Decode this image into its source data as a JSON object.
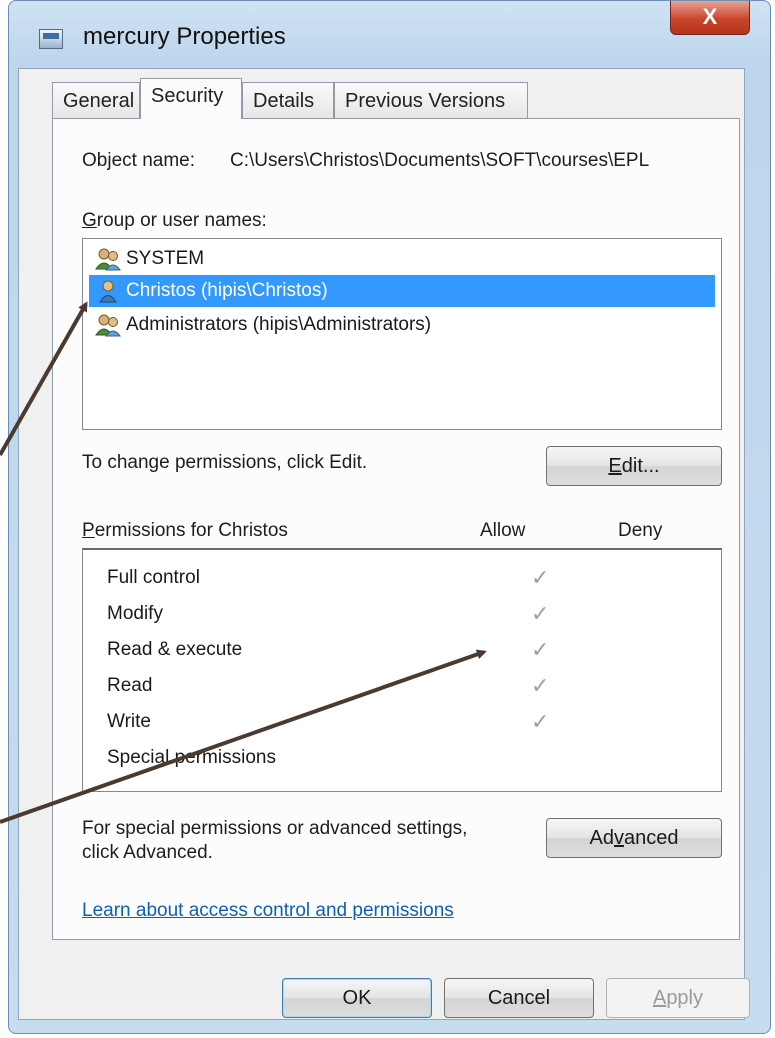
{
  "window": {
    "title": "mercury Properties",
    "close_label": "X"
  },
  "tabs": [
    {
      "label": "General"
    },
    {
      "label": "Security",
      "active": true
    },
    {
      "label": "Details"
    },
    {
      "label": "Previous Versions"
    }
  ],
  "object_name": {
    "label": "Object name:",
    "value": "C:\\Users\\Christos\\Documents\\SOFT\\courses\\EPL"
  },
  "group_list": {
    "label": "Group or user names:",
    "items": [
      {
        "label": "SYSTEM",
        "icon": "users-group-icon"
      },
      {
        "label": "Christos (hipis\\Christos)",
        "icon": "user-icon",
        "selected": true
      },
      {
        "label": "Administrators (hipis\\Administrators)",
        "icon": "users-group-icon"
      }
    ]
  },
  "change_permissions": {
    "text": "To change permissions, click Edit.",
    "edit_label": "Edit..."
  },
  "permissions": {
    "title": "Permissions for Christos",
    "allow_header": "Allow",
    "deny_header": "Deny",
    "rows": [
      {
        "label": "Full control",
        "allow": "✓",
        "deny": ""
      },
      {
        "label": "Modify",
        "allow": "✓",
        "deny": ""
      },
      {
        "label": "Read & execute",
        "allow": "✓",
        "deny": ""
      },
      {
        "label": "Read",
        "allow": "✓",
        "deny": ""
      },
      {
        "label": "Write",
        "allow": "✓",
        "deny": ""
      },
      {
        "label": "Special permissions",
        "allow": "",
        "deny": ""
      }
    ]
  },
  "advanced": {
    "text_line1": "For special permissions or advanced settings,",
    "text_line2": "click Advanced.",
    "button_label": "Advanced"
  },
  "link": {
    "text": "Learn about access control and permissions"
  },
  "footer": {
    "ok_label": "OK",
    "cancel_label": "Cancel",
    "apply_label": "Apply"
  },
  "colors": {
    "selection": "#3399ff",
    "link": "#0f5fb3",
    "arrow": "#4a3a30"
  }
}
